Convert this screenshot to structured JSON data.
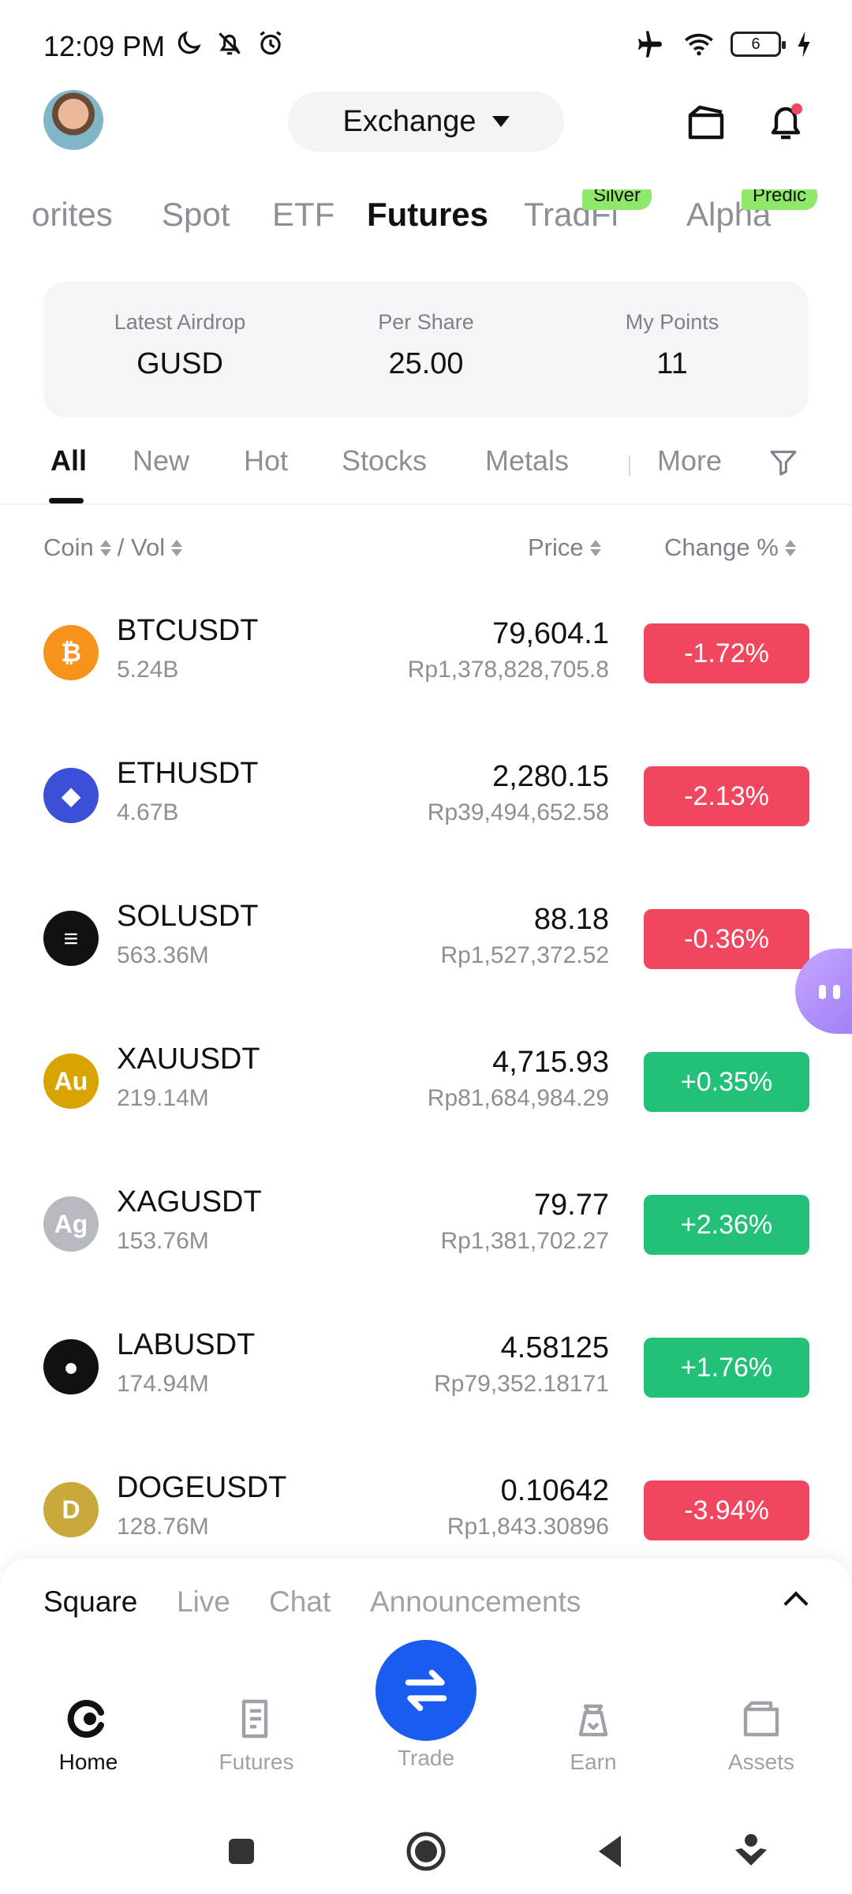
{
  "status_bar": {
    "time": "12:09 PM",
    "left_icons": [
      "moon-icon",
      "bell-off-icon",
      "alarm-icon"
    ],
    "right_icons": [
      "airplane-icon",
      "wifi-icon",
      "battery-icon",
      "charging-icon"
    ],
    "battery_level": "6"
  },
  "header": {
    "exchange_label": "Exchange",
    "has_notification_dot": true
  },
  "category_tabs": [
    {
      "label": "orites",
      "active": false
    },
    {
      "label": "Spot",
      "active": false
    },
    {
      "label": "ETF",
      "active": false
    },
    {
      "label": "Futures",
      "active": true
    },
    {
      "label": "TradFi",
      "active": false,
      "tag": "Silver"
    },
    {
      "label": "Alpha",
      "active": false,
      "tag": "Predic"
    }
  ],
  "airdrop": {
    "latest_label": "Latest Airdrop",
    "latest_value": "GUSD",
    "per_share_label": "Per Share",
    "per_share_value": "25.00",
    "points_label": "My Points",
    "points_value": "11"
  },
  "filter_tabs": [
    {
      "label": "All",
      "active": true
    },
    {
      "label": "New",
      "active": false
    },
    {
      "label": "Hot",
      "active": false
    },
    {
      "label": "Stocks",
      "active": false
    },
    {
      "label": "Metals",
      "active": false
    },
    {
      "label": "More",
      "active": false
    }
  ],
  "columns": {
    "coin": "Coin",
    "vol": "/ Vol",
    "price": "Price",
    "change": "Change %"
  },
  "markets": [
    {
      "symbol": "BTCUSDT",
      "volume": "5.24B",
      "price": "79,604.1",
      "fiat": "Rp1,378,828,705.8",
      "change": "-1.72%",
      "direction": "neg",
      "icon": "btc-icon",
      "icon_text": "₿",
      "icon_color": "#f7931a"
    },
    {
      "symbol": "ETHUSDT",
      "volume": "4.67B",
      "price": "2,280.15",
      "fiat": "Rp39,494,652.58",
      "change": "-2.13%",
      "direction": "neg",
      "icon": "eth-icon",
      "icon_text": "◆",
      "icon_color": "#3b50d6"
    },
    {
      "symbol": "SOLUSDT",
      "volume": "563.36M",
      "price": "88.18",
      "fiat": "Rp1,527,372.52",
      "change": "-0.36%",
      "direction": "neg",
      "icon": "sol-icon",
      "icon_text": "≡",
      "icon_color": "#111111"
    },
    {
      "symbol": "XAUUSDT",
      "volume": "219.14M",
      "price": "4,715.93",
      "fiat": "Rp81,684,984.29",
      "change": "+0.35%",
      "direction": "pos",
      "icon": "gold-icon",
      "icon_text": "Au",
      "icon_color": "#d9a400"
    },
    {
      "symbol": "XAGUSDT",
      "volume": "153.76M",
      "price": "79.77",
      "fiat": "Rp1,381,702.27",
      "change": "+2.36%",
      "direction": "pos",
      "icon": "silver-icon",
      "icon_text": "Ag",
      "icon_color": "#b7b9c0"
    },
    {
      "symbol": "LABUSDT",
      "volume": "174.94M",
      "price": "4.58125",
      "fiat": "Rp79,352.18171",
      "change": "+1.76%",
      "direction": "pos",
      "icon": "lab-icon",
      "icon_text": "●",
      "icon_color": "#111111"
    },
    {
      "symbol": "DOGEUSDT",
      "volume": "128.76M",
      "price": "0.10642",
      "fiat": "Rp1,843.30896",
      "change": "-3.94%",
      "direction": "neg",
      "icon": "doge-icon",
      "icon_text": "D",
      "icon_color": "#c9a93b"
    }
  ],
  "feed_tabs": [
    {
      "label": "Square",
      "active": true
    },
    {
      "label": "Live",
      "active": false
    },
    {
      "label": "Chat",
      "active": false
    },
    {
      "label": "Announcements",
      "active": false
    }
  ],
  "bottom_nav": {
    "home": "Home",
    "futures": "Futures",
    "trade": "Trade",
    "earn": "Earn",
    "assets": "Assets"
  },
  "colors": {
    "negative": "#f0475f",
    "positive": "#23c07a",
    "accent": "#1a5cf0",
    "tag_green": "#8ee86a"
  }
}
